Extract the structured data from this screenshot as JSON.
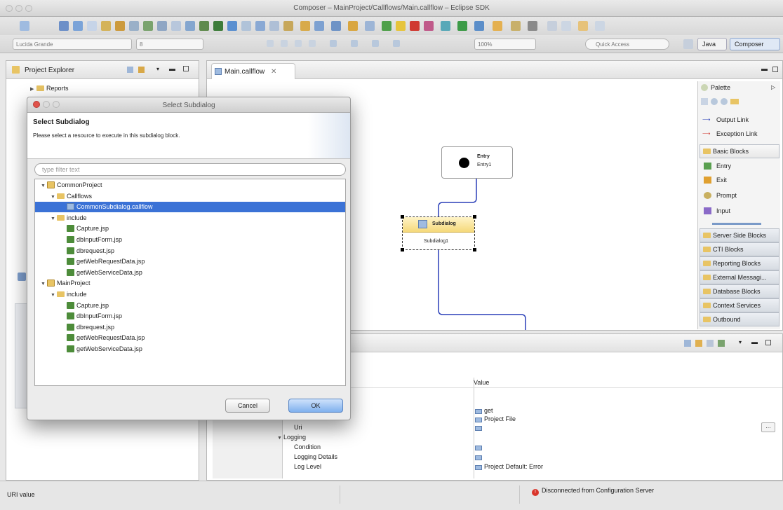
{
  "window": {
    "title": "Composer – MainProject/Callflows/Main.callflow – Eclipse SDK"
  },
  "toolbar": {
    "font_name": "Lucida Grande",
    "font_size": "8",
    "zoom": "100%",
    "quick_access_placeholder": "Quick Access",
    "perspectives": [
      "Java",
      "Composer"
    ]
  },
  "explorer": {
    "title": "Project Explorer",
    "items": [
      "Reports"
    ]
  },
  "editor": {
    "tab_label": "Main.callflow",
    "entry_block": {
      "title": "Entry",
      "subtitle": "Entry1"
    },
    "subdialog_block": {
      "title": "Subdialog",
      "subtitle": "Subdialog1"
    }
  },
  "palette": {
    "title": "Palette",
    "links": [
      "Output Link",
      "Exception Link"
    ],
    "basic_drawer": "Basic Blocks",
    "basic_items": [
      "Entry",
      "Exit",
      "Prompt",
      "Input"
    ],
    "drawers": [
      "Server Side Blocks",
      "CTI Blocks",
      "Reporting Blocks",
      "External Messagi...",
      "Database Blocks",
      "Context Services",
      "Outbound"
    ]
  },
  "properties": {
    "value_header": "Value",
    "rows": [
      {
        "name": "",
        "value": "get"
      },
      {
        "name": "",
        "value": "Project File"
      },
      {
        "name": "Uri",
        "value": ""
      },
      {
        "name": "Logging",
        "value": ""
      },
      {
        "name": "Condition",
        "value": ""
      },
      {
        "name": "Logging Details",
        "value": ""
      },
      {
        "name": "Log Level",
        "value": "Project Default: Error"
      }
    ]
  },
  "status": {
    "left": "URI value",
    "connection": "Disconnected from Configuration Server",
    "connection_color": "#d9352b"
  },
  "dialog": {
    "title": "Select Subdialog",
    "heading": "Select Subdialog",
    "description": "Please select a resource to execute in this subdialog block.",
    "filter_placeholder": "type filter text",
    "tree": [
      {
        "label": "CommonProject",
        "level": 0,
        "kind": "project",
        "expanded": true
      },
      {
        "label": "Callflows",
        "level": 1,
        "kind": "folder",
        "expanded": true
      },
      {
        "label": "CommonSubdialog.callflow",
        "level": 2,
        "kind": "callflow",
        "selected": true
      },
      {
        "label": "include",
        "level": 1,
        "kind": "folder",
        "expanded": true
      },
      {
        "label": "Capture.jsp",
        "level": 2,
        "kind": "jsp"
      },
      {
        "label": "dbInputForm.jsp",
        "level": 2,
        "kind": "jsp"
      },
      {
        "label": "dbrequest.jsp",
        "level": 2,
        "kind": "jsp"
      },
      {
        "label": "getWebRequestData.jsp",
        "level": 2,
        "kind": "jsp"
      },
      {
        "label": "getWebServiceData.jsp",
        "level": 2,
        "kind": "jsp"
      },
      {
        "label": "MainProject",
        "level": 0,
        "kind": "project",
        "expanded": true
      },
      {
        "label": "include",
        "level": 1,
        "kind": "folder",
        "expanded": true
      },
      {
        "label": "Capture.jsp",
        "level": 2,
        "kind": "jsp"
      },
      {
        "label": "dbInputForm.jsp",
        "level": 2,
        "kind": "jsp"
      },
      {
        "label": "dbrequest.jsp",
        "level": 2,
        "kind": "jsp"
      },
      {
        "label": "getWebRequestData.jsp",
        "level": 2,
        "kind": "jsp"
      },
      {
        "label": "getWebServiceData.jsp",
        "level": 2,
        "kind": "jsp"
      }
    ],
    "cancel_label": "Cancel",
    "ok_label": "OK"
  }
}
